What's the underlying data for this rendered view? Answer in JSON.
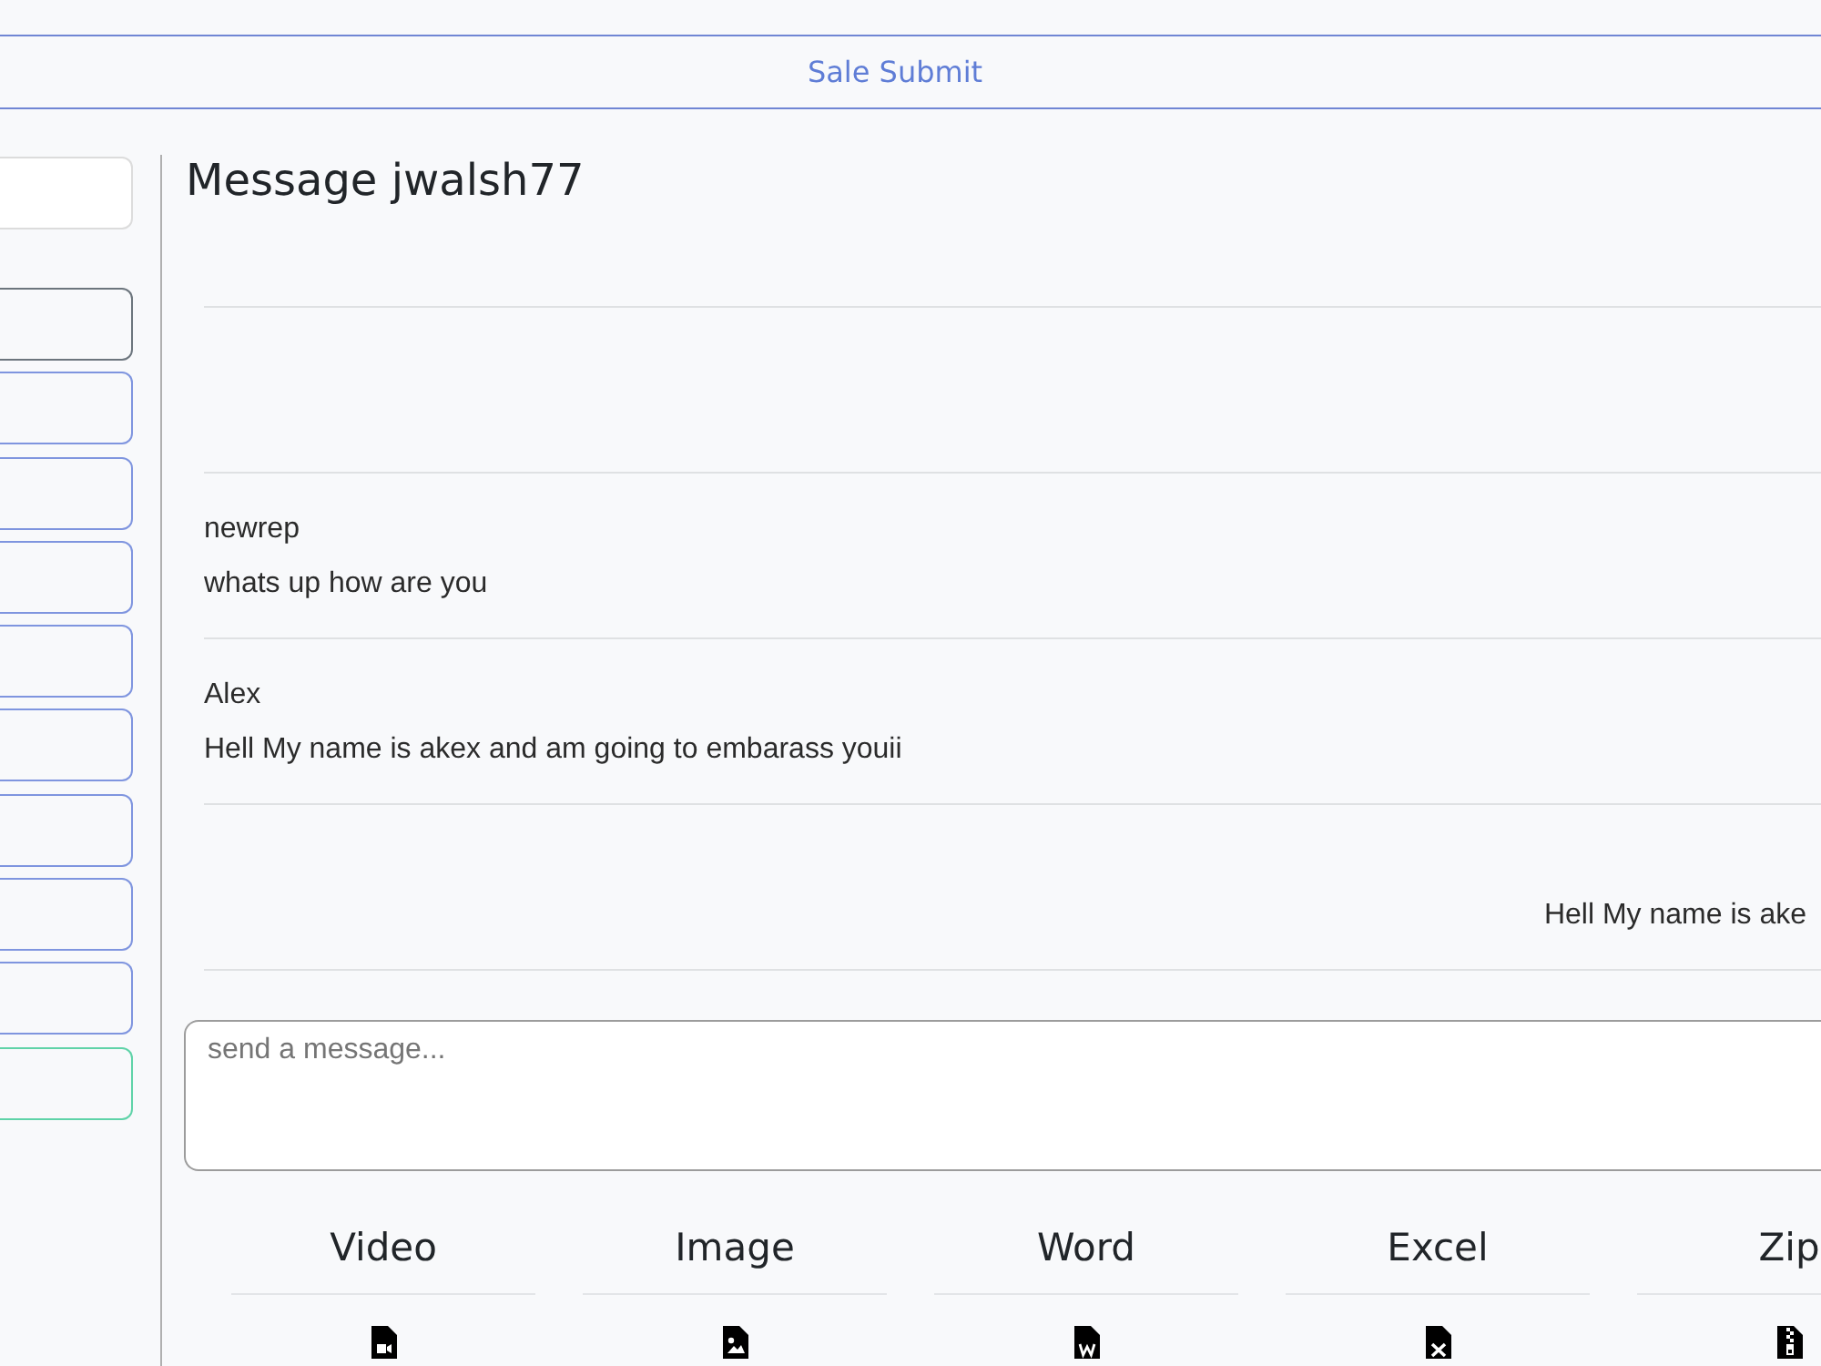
{
  "header": {
    "title": "Sale Submit"
  },
  "sidebar": {
    "buttons": [
      {
        "color": "#6c757d"
      },
      {
        "color": "#7f95df"
      },
      {
        "color": "#7f95df"
      },
      {
        "color": "#7f95df"
      },
      {
        "color": "#7f95df"
      },
      {
        "color": "#7f95df"
      },
      {
        "color": "#7f95df"
      },
      {
        "color": "#7f95df"
      },
      {
        "color": "#7f95df"
      },
      {
        "color": "#5fd3a8"
      }
    ]
  },
  "conversation": {
    "title": "Message jwalsh77",
    "messages": [
      {
        "kind": "received",
        "author": "newrep",
        "text": "whats up how are you"
      },
      {
        "kind": "received",
        "author": "Alex",
        "text": "Hell My name is akex and am going to embarass youii"
      },
      {
        "kind": "sent",
        "text": "Hell My name is ake"
      }
    ]
  },
  "composer": {
    "placeholder": "send a message..."
  },
  "attachments": [
    {
      "label": "Video",
      "kind": "video"
    },
    {
      "label": "Image",
      "kind": "image"
    },
    {
      "label": "Word",
      "kind": "word"
    },
    {
      "label": "Excel",
      "kind": "excel"
    },
    {
      "label": "Zip",
      "kind": "zip"
    }
  ]
}
